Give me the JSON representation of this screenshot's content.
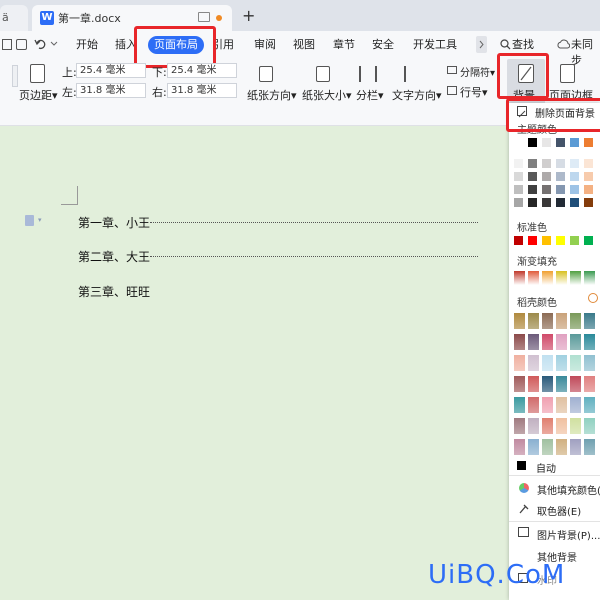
{
  "tabs": {
    "prev_label": "ä",
    "doc_title": "第一章.docx",
    "logo": "W",
    "add": "+"
  },
  "menu": {
    "items": [
      "开始",
      "插入",
      "页面布局",
      "引用",
      "审阅",
      "视图",
      "章节",
      "安全",
      "开发工具"
    ],
    "search": "查找",
    "sync": "未同步"
  },
  "toolbar": {
    "margin_label": "页边距",
    "top_label": "上:",
    "top_value": "25.4 毫米",
    "bottom_label": "下:",
    "bottom_value": "25.4 毫米",
    "left_label": "左:",
    "left_value": "31.8 毫米",
    "right_label": "右:",
    "right_value": "31.8 毫米",
    "orientation": "纸张方向",
    "size": "纸张大小",
    "columns": "分栏",
    "text_direction": "文字方向",
    "separator": "分隔符",
    "line_number": "行号",
    "background": "背景",
    "page_border": "页面边框"
  },
  "document": {
    "lines": [
      "第一章、小王",
      "第二章、大王",
      "第三章、旺旺"
    ]
  },
  "dropdown": {
    "delete_bg": "删除页面背景",
    "theme_colors": "主题颜色",
    "standard_colors": "标准色",
    "gradient_fill": "渐变填充",
    "daoke_colors": "稻壳颜色",
    "auto": "自动",
    "more_fill": "其他填充颜色(",
    "eyedropper": "取色器(E)",
    "picture_bg": "图片背景(P)...",
    "other_bg": "其他背景",
    "watermark_item": "水印"
  },
  "colors": {
    "standard": [
      "#c00000",
      "#ff0000",
      "#ffc000",
      "#ffff00",
      "#92d050",
      "#00b050"
    ],
    "gradient": [
      "#c0392b",
      "#e05a3a",
      "#f0a030",
      "#d8c020",
      "#50a040",
      "#3a9a50"
    ],
    "accent": "#2d6df6",
    "highlight_red": "#e8262a"
  },
  "watermark_text": "UiBQ.CoM"
}
